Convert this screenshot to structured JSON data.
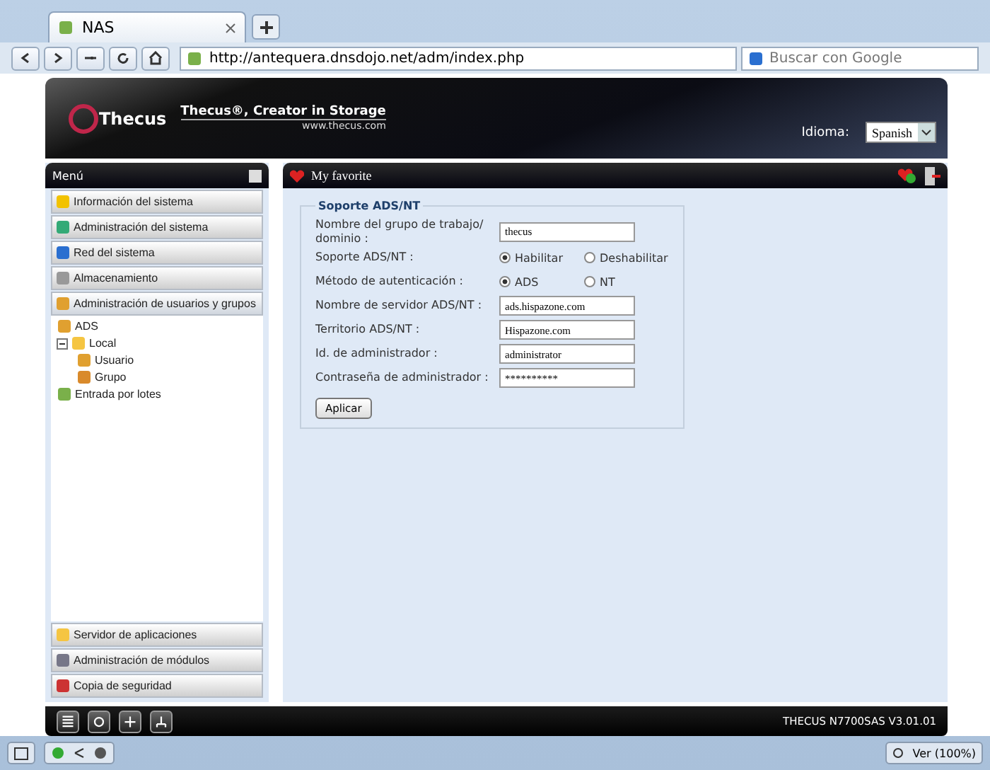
{
  "browser": {
    "tab_title": "NAS",
    "url": "http://antequera.dnsdojo.net/adm/index.php",
    "search_placeholder": "Buscar con Google"
  },
  "header": {
    "brand": "Thecus",
    "tagline": "Thecus®, Creator in Storage",
    "website": "www.thecus.com",
    "language_label": "Idioma:",
    "language": "Spanish"
  },
  "menu": {
    "title": "Menú",
    "top_items": [
      {
        "label": "Información del sistema",
        "expanded": false
      },
      {
        "label": "Administración del sistema",
        "expanded": false
      },
      {
        "label": "Red del sistema",
        "expanded": false
      },
      {
        "label": "Almacenamiento",
        "expanded": false
      },
      {
        "label": "Administración de usuarios y grupos",
        "expanded": true
      }
    ],
    "tree": [
      {
        "label": "ADS"
      },
      {
        "label": "Local",
        "expanded": true,
        "children": [
          {
            "label": "Usuario"
          },
          {
            "label": "Grupo"
          }
        ]
      },
      {
        "label": "Entrada por lotes"
      }
    ],
    "bottom_items": [
      {
        "label": "Servidor de aplicaciones"
      },
      {
        "label": "Administración de módulos"
      },
      {
        "label": "Copia de seguridad"
      }
    ]
  },
  "main": {
    "favorite": "My favorite",
    "legend": "Soporte ADS/NT",
    "fields": [
      {
        "kind": "text",
        "label": "Nombre del grupo de trabajo/ dominio :",
        "value": "thecus"
      },
      {
        "kind": "radio",
        "label": "Soporte ADS/NT :",
        "options": [
          {
            "label": "Habilitar",
            "selected": true
          },
          {
            "label": "Deshabilitar",
            "selected": false
          }
        ]
      },
      {
        "kind": "radio",
        "label": "Método de autenticación :",
        "options": [
          {
            "label": "ADS",
            "selected": true
          },
          {
            "label": "NT",
            "selected": false
          }
        ]
      },
      {
        "kind": "text",
        "label": "Nombre de servidor ADS/NT :",
        "value": "ads.hispazone.com"
      },
      {
        "kind": "text",
        "label": "Territorio ADS/NT :",
        "value": "Hispazone.com"
      },
      {
        "kind": "text",
        "label": "Id. de administrador :",
        "value": "administrator"
      },
      {
        "kind": "text",
        "label": "Contraseña de administrador :",
        "value": "**********"
      }
    ],
    "apply": "Aplicar"
  },
  "footer": {
    "version": "THECUS N7700SAS V3.01.01"
  },
  "status_bar": {
    "zoom": "Ver (100%)"
  }
}
